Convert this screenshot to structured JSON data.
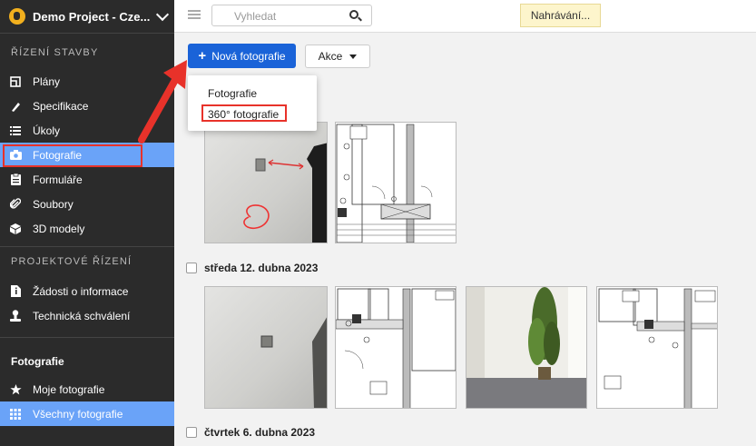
{
  "project": {
    "name": "Demo Project - Cze..."
  },
  "sidebar": {
    "section_construction": "ŘÍZENÍ STAVBY",
    "construction_items": [
      {
        "label": "Plány",
        "icon": "plans-icon"
      },
      {
        "label": "Specifikace",
        "icon": "spec-icon"
      },
      {
        "label": "Úkoly",
        "icon": "tasks-icon"
      },
      {
        "label": "Fotografie",
        "icon": "camera-icon"
      },
      {
        "label": "Formuláře",
        "icon": "forms-icon"
      },
      {
        "label": "Soubory",
        "icon": "paperclip-icon"
      },
      {
        "label": "3D modely",
        "icon": "cube-icon"
      }
    ],
    "section_project": "PROJEKTOVÉ ŘÍZENÍ",
    "project_items": [
      {
        "label": "Žádosti o informace",
        "icon": "document-info-icon"
      },
      {
        "label": "Technická schválení",
        "icon": "person-stamp-icon"
      }
    ],
    "photos_section": "Fotografie",
    "photo_items": [
      {
        "label": "Moje fotografie",
        "icon": "star-icon"
      },
      {
        "label": "Všechny fotografie",
        "icon": "grid-icon"
      }
    ]
  },
  "topbar": {
    "search_placeholder": "Vyhledat",
    "upload_status": "Nahrávání..."
  },
  "toolbar": {
    "new_photo_label": "Nová fotografie",
    "actions_label": "Akce"
  },
  "dropdown": {
    "items": [
      "Fotografie",
      "360° fotografie"
    ]
  },
  "gallery": {
    "days": [
      {
        "label": "středa 12. dubna 2023"
      },
      {
        "label": "čtvrtek 6. dubna 2023"
      }
    ]
  },
  "colors": {
    "accent": "#1a63d8",
    "sidebar_bg": "#2b2b2b",
    "sidebar_active": "#6aa3f8",
    "annotation_red": "#e8322a"
  }
}
